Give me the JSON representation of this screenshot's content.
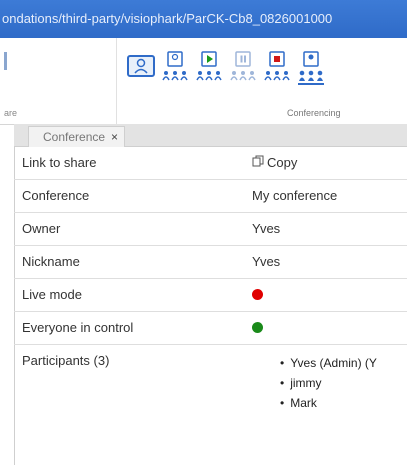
{
  "window": {
    "title_text": "ondations/third-party/visiophark/ParCK-Cb8_0826001000"
  },
  "ribbon": {
    "left_group_label": "are",
    "group_label": "Conferencing",
    "icons": [
      "screen-share-icon",
      "participants-icon",
      "play-participants-icon",
      "pause-participants-icon",
      "stop-participants-icon",
      "people-group-icon"
    ]
  },
  "panel": {
    "tab_label": "Conference",
    "close_glyph": "×"
  },
  "rows": [
    {
      "key": "Link to share",
      "value": "Copy"
    },
    {
      "key": "Conference",
      "value": "My conference"
    },
    {
      "key": "Owner",
      "value": "Yves"
    },
    {
      "key": "Nickname",
      "value": "Yves"
    },
    {
      "key": "Live mode",
      "status_color": "#e00000"
    },
    {
      "key": "Everyone in control",
      "status_color": "#1a8a1a"
    }
  ],
  "participants": {
    "label": "Participants (3)",
    "items": [
      "Yves (Admin) (Y",
      "jimmy",
      "Mark"
    ]
  }
}
